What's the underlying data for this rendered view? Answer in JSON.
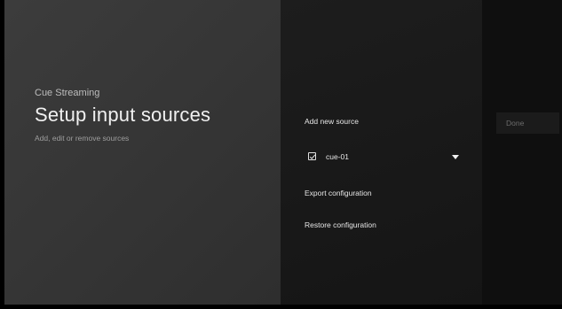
{
  "app": {
    "name": "Cue Streaming"
  },
  "header": {
    "title": "Setup input sources",
    "subtitle": "Add, edit or remove sources"
  },
  "menu": {
    "add_source_label": "Add new source",
    "sources": [
      {
        "label": "cue-01",
        "checked": true,
        "icon": "chevron-down-icon"
      }
    ],
    "export_label": "Export configuration",
    "restore_label": "Restore configuration"
  },
  "actions": {
    "done_label": "Done"
  },
  "colors": {
    "left_panel": "#383838",
    "middle_panel": "#1a1a1a",
    "right_panel": "#0f0f0f",
    "text_primary": "#e6e6e6",
    "text_muted": "#9e9e9e",
    "done_disabled_text": "#6c6c6c"
  }
}
